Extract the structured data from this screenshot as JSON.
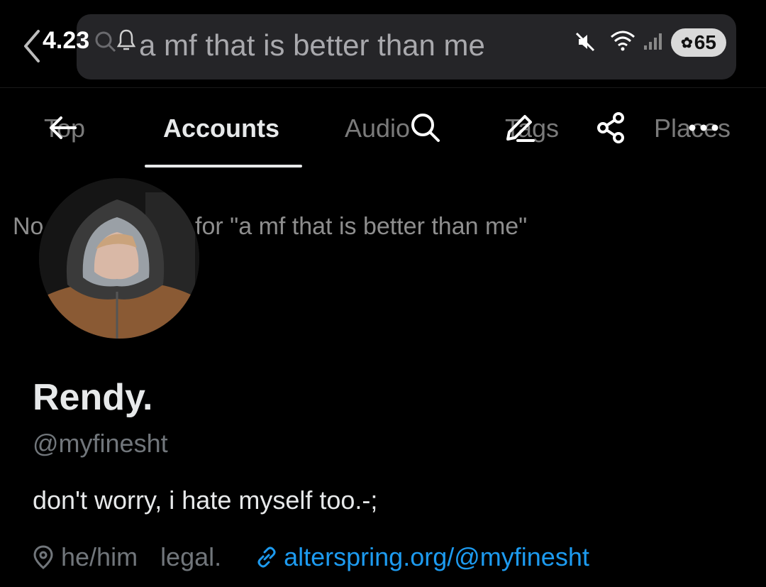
{
  "status_bar": {
    "time": "4.23",
    "battery": "65"
  },
  "search": {
    "query": "a mf that is better than me"
  },
  "tabs": [
    {
      "label": "Top",
      "active": false
    },
    {
      "label": "Accounts",
      "active": true
    },
    {
      "label": "Audio",
      "active": false
    },
    {
      "label": "Tags",
      "active": false
    },
    {
      "label": "Places",
      "active": false
    }
  ],
  "no_results": "No results found for \"a mf that is better than me\"",
  "profile": {
    "name": "Rendy.",
    "handle": "@myfinesht",
    "bio": "don't worry, i hate myself too.-;",
    "pronouns": "he/him",
    "role": "legal.",
    "link": "alterspring.org/@myfinesht"
  },
  "colors": {
    "background": "#000000",
    "text": "#e7e9ea",
    "muted": "#71767b",
    "link": "#1d9bf0"
  }
}
